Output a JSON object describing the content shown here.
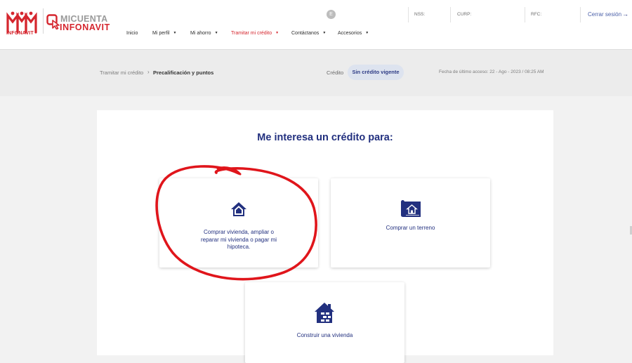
{
  "brand": {
    "infonavit_label": "INFONAVIT",
    "micuenta_line1": "MICUENTA",
    "micuenta_line2": "INFONAVIT"
  },
  "header": {
    "avatar_initial": "E",
    "nss_label": "NSS:",
    "curp_label": "CURP:",
    "rfc_label": "RFC:",
    "logout_label": "Cerrar sesión",
    "nav": [
      {
        "label": "Inicio"
      },
      {
        "label": "Mi perfil"
      },
      {
        "label": "Mi ahorro"
      },
      {
        "label": "Tramitar mi crédito"
      },
      {
        "label": "Contáctanos"
      },
      {
        "label": "Accesorios"
      }
    ]
  },
  "breadcrumb": {
    "parent": "Tramitar mi crédito",
    "separator": "›",
    "current": "Precalificación y puntos"
  },
  "credit_status": {
    "label": "Crédito",
    "value": "Sin crédito vigente"
  },
  "last_access": "Fecha de último acceso: 22 - Ago - 2023 / 08:25 AM",
  "main": {
    "title": "Me interesa un crédito para:",
    "options": [
      {
        "icon": "house-icon",
        "label": "Comprar vivienda, ampliar o reparar mi vivienda o pagar mi hipoteca."
      },
      {
        "icon": "land-blueprint-icon",
        "label": "Comprar un terreno"
      },
      {
        "icon": "house-build-icon",
        "label": "Construir una vivienda"
      }
    ]
  },
  "colors": {
    "brand_red": "#d5262e",
    "brand_blue": "#22307f",
    "annotation_red": "#e0151b",
    "page_bg": "#f2f2f2"
  }
}
